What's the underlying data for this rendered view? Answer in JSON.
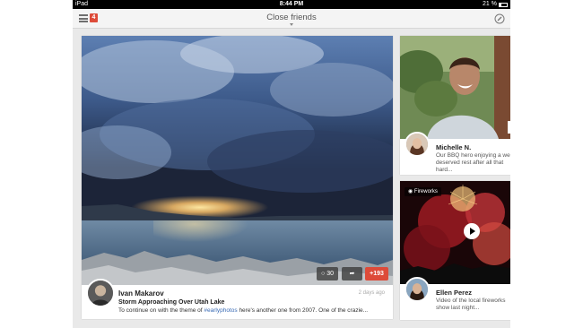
{
  "status_bar": {
    "carrier": "iPad",
    "time": "8:44 PM",
    "battery": "21 %"
  },
  "app_bar": {
    "circle_name": "Close friends",
    "notification_count": "4"
  },
  "main_post": {
    "author": "Ivan Makarov",
    "time": "2 days ago",
    "title": "Storm Approaching Over Utah Lake",
    "text_before": "To continue on with the theme of ",
    "hashtag": "#earlyphotos",
    "text_after": " here's another one from 2007. One of the crazie...",
    "comments": "30",
    "plus_ones": "+193"
  },
  "side_posts": [
    {
      "author": "Michelle N.",
      "text": "Our BBQ hero enjoying a well-deserved rest after all that hard..."
    },
    {
      "tag": "Fireworks",
      "author": "Ellen Perez",
      "text": "Video of the local fireworks show last night..."
    }
  ],
  "colors": {
    "accent": "#dd4b39",
    "hashtag": "#3a6bb5"
  },
  "icons": [
    "menu-icon",
    "gplus-notification-icon",
    "compose-icon",
    "comment-icon",
    "share-icon",
    "play-icon",
    "video-icon"
  ]
}
